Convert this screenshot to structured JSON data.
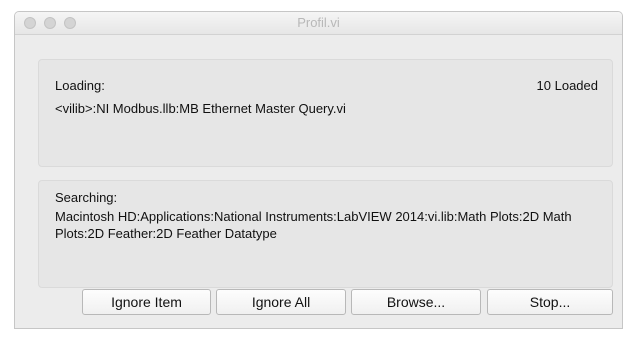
{
  "window": {
    "title": "Profil.vi"
  },
  "loading": {
    "label": "Loading:",
    "count_text": "10 Loaded",
    "path": "<vilib>:NI Modbus.llb:MB Ethernet Master Query.vi"
  },
  "searching": {
    "label": "Searching:",
    "path": "Macintosh HD:Applications:National Instruments:LabVIEW 2014:vi.lib:Math Plots:2D Math Plots:2D Feather:2D Feather Datatype"
  },
  "buttons": {
    "ignore_item": "Ignore Item",
    "ignore_all": "Ignore All",
    "browse": "Browse...",
    "stop": "Stop..."
  }
}
